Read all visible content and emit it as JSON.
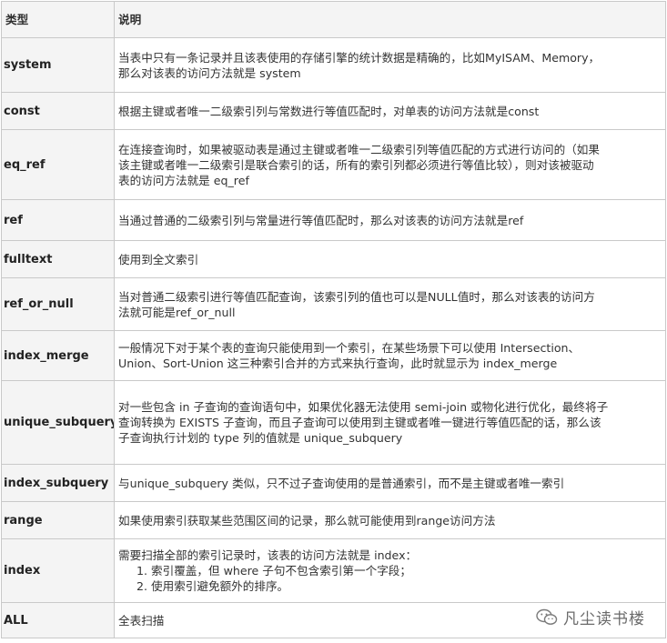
{
  "header": {
    "col_type": "类型",
    "col_desc": "说明"
  },
  "rows": [
    {
      "type": "system",
      "desc": [
        "当表中只有一条记录并且该表使用的存储引擎的统计数据是精确的，比如MyISAM、Memory，",
        "那么对该表的访问方法就是 system"
      ]
    },
    {
      "type": "const",
      "desc": [
        "根据主键或者唯一二级索引列与常数进行等值匹配时，对单表的访问方法就是const"
      ]
    },
    {
      "type": "eq_ref",
      "desc": [
        "在连接查询时，如果被驱动表是通过主键或者唯一二级索引列等值匹配的方式进行访问的（如果",
        "该主键或者唯一二级索引是联合索引的话，所有的索引列都必须进行等值比较），则对该被驱动",
        "表的访问方法就是 eq_ref"
      ]
    },
    {
      "type": "ref",
      "desc": [
        "当通过普通的二级索引列与常量进行等值匹配时，那么对该表的访问方法就是ref"
      ]
    },
    {
      "type": "fulltext",
      "desc": [
        "使用到全文索引"
      ]
    },
    {
      "type": "ref_or_null",
      "desc": [
        "当对普通二级索引进行等值匹配查询，该索引列的值也可以是NULL值时，那么对该表的访问方",
        "法就可能是ref_or_null"
      ]
    },
    {
      "type": "index_merge",
      "desc": [
        "一般情况下对于某个表的查询只能使用到一个索引，在某些场景下可以使用 Intersection、",
        "Union、Sort-Union 这三种索引合并的方式来执行查询，此时就显示为 index_merge"
      ]
    },
    {
      "type": "unique_subquery",
      "desc": [
        "对一些包含 in 子查询的查询语句中，如果优化器无法使用 semi-join 或物化进行优化，最终将子",
        "查询转换为 EXISTS 子查询，而且子查询可以使用到主键或者唯一键进行等值匹配的话，那么该",
        "子查询执行计划的 type 列的值就是 unique_subquery"
      ]
    },
    {
      "type": "index_subquery",
      "desc": [
        "与unique_subquery 类似，只不过子查询使用的是普通索引，而不是主键或者唯一索引"
      ]
    },
    {
      "type": "range",
      "desc": [
        "如果使用索引获取某些范围区间的记录，那么就可能使用到range访问方法"
      ]
    },
    {
      "type": "index",
      "desc": [
        "需要扫描全部的索引记录时，该表的访问方法就是 index：",
        "1. 索引覆盖，但 where 子句不包含索引第一个字段；",
        "2. 使用索引避免额外的排序。"
      ]
    },
    {
      "type": "ALL",
      "desc": [
        "全表扫描"
      ]
    }
  ],
  "watermark": {
    "text": "凡尘读书楼",
    "icon": "wechat-icon"
  }
}
